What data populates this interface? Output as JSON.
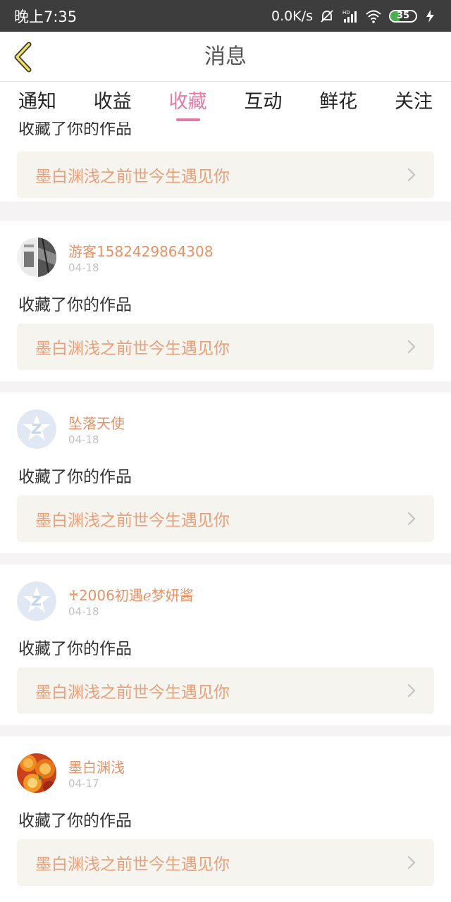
{
  "status_bar": {
    "time": "晚上7:35",
    "network_speed": "0.0K/s",
    "signal_label": "HD",
    "battery": "35",
    "battery_level": 0.35
  },
  "header": {
    "title": "消息",
    "back_icon": "chevron-left-icon"
  },
  "tabs": [
    {
      "label": "通知",
      "active": false
    },
    {
      "label": "收益",
      "active": false
    },
    {
      "label": "收藏",
      "active": true
    },
    {
      "label": "互动",
      "active": false
    },
    {
      "label": "鲜花",
      "active": false
    },
    {
      "label": "关注",
      "active": false
    }
  ],
  "colors": {
    "accent": "#e678a8",
    "username": "#e99163",
    "work_title": "#e9a07a",
    "date": "#c1c1c1"
  },
  "messages": [
    {
      "action": "收藏了你的作品",
      "work_title": "墨白渊浅之前世今生遇见你"
    },
    {
      "username": "游客1582429864308",
      "date": "04-18",
      "avatar": "photo-avatar",
      "action": "收藏了你的作品",
      "work_title": "墨白渊浅之前世今生遇见你"
    },
    {
      "username": "坠落天使",
      "date": "04-18",
      "avatar": "default-avatar",
      "action": "收藏了你的作品",
      "work_title": "墨白渊浅之前世今生遇见你"
    },
    {
      "username": "♰2006初遇ℯ梦妍酱",
      "date": "04-18",
      "avatar": "default-avatar",
      "action": "收藏了你的作品",
      "work_title": "墨白渊浅之前世今生遇见你"
    },
    {
      "username": "墨白渊浅",
      "date": "04-17",
      "avatar": "orange-photo-avatar",
      "action": "收藏了你的作品",
      "work_title": "墨白渊浅之前世今生遇见你"
    }
  ]
}
